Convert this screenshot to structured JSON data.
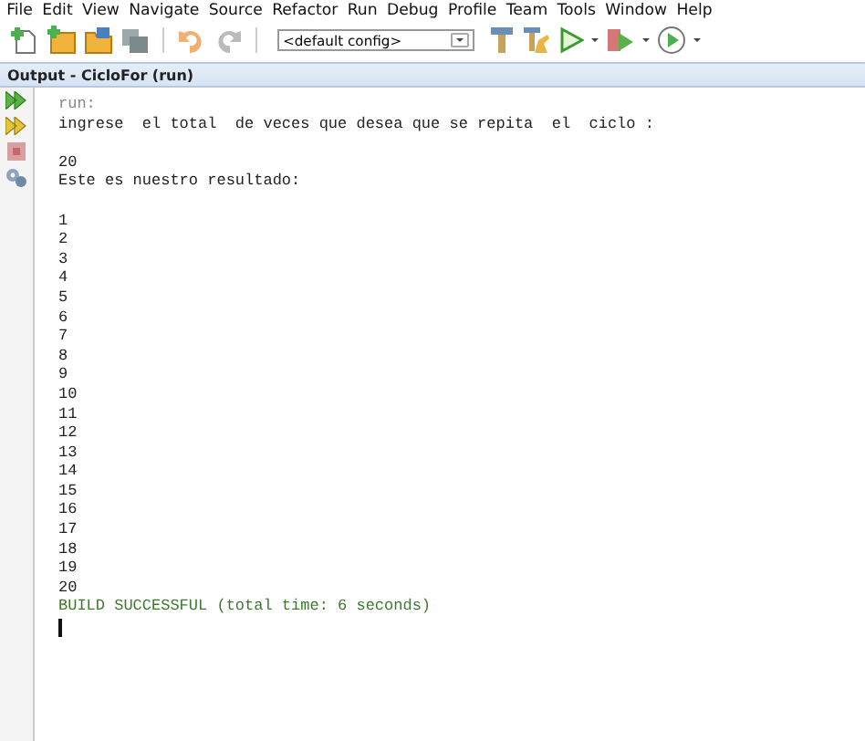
{
  "menu_bar": [
    "File",
    "Edit",
    "View",
    "Navigate",
    "Source",
    "Refactor",
    "Run",
    "Debug",
    "Profile",
    "Team",
    "Tools",
    "Window",
    "Help"
  ],
  "toolbar": {
    "config": "<default config>"
  },
  "output": {
    "title": "Output - CicloFor (run)",
    "lines": [
      {
        "kind": "meta",
        "text": "run:"
      },
      {
        "kind": "normal",
        "text": "ingrese  el total  de veces que desea que se repita  el  ciclo :"
      },
      {
        "kind": "blank"
      },
      {
        "kind": "normal",
        "text": "20"
      },
      {
        "kind": "normal",
        "text": "Este es nuestro resultado:"
      },
      {
        "kind": "blank"
      },
      {
        "kind": "normal",
        "text": "1"
      },
      {
        "kind": "normal",
        "text": "2"
      },
      {
        "kind": "normal",
        "text": "3"
      },
      {
        "kind": "normal",
        "text": "4"
      },
      {
        "kind": "normal",
        "text": "5"
      },
      {
        "kind": "normal",
        "text": "6"
      },
      {
        "kind": "normal",
        "text": "7"
      },
      {
        "kind": "normal",
        "text": "8"
      },
      {
        "kind": "normal",
        "text": "9"
      },
      {
        "kind": "normal",
        "text": "10"
      },
      {
        "kind": "normal",
        "text": "11"
      },
      {
        "kind": "normal",
        "text": "12"
      },
      {
        "kind": "normal",
        "text": "13"
      },
      {
        "kind": "normal",
        "text": "14"
      },
      {
        "kind": "normal",
        "text": "15"
      },
      {
        "kind": "normal",
        "text": "16"
      },
      {
        "kind": "normal",
        "text": "17"
      },
      {
        "kind": "normal",
        "text": "18"
      },
      {
        "kind": "normal",
        "text": "19"
      },
      {
        "kind": "normal",
        "text": "20"
      },
      {
        "kind": "success",
        "text": "BUILD SUCCESSFUL (total time: 6 seconds)"
      },
      {
        "kind": "cursor"
      }
    ]
  }
}
